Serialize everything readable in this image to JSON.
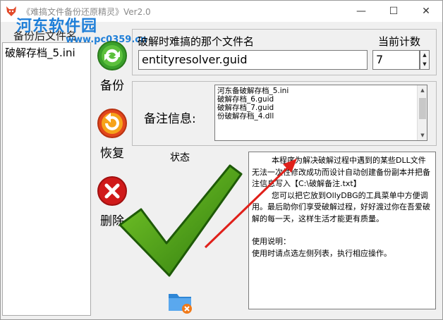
{
  "window": {
    "title": "《难搞文件备份还原精灵》Ver2.0",
    "controls": {
      "minimize": "—",
      "maximize": "☐",
      "close": "✕"
    }
  },
  "watermark": {
    "logo": "河东软件园",
    "url": "www.pc0359.cn"
  },
  "file_list": {
    "header": "备份后文件名",
    "items": [
      "破解存档_5.ini"
    ]
  },
  "actions": {
    "backup": "备份",
    "restore": "恢复",
    "delete": "删除"
  },
  "filename": {
    "label": "破解时难搞的那个文件名",
    "value": "entityresolver.guid"
  },
  "counter": {
    "label": "当前计数",
    "value": "7"
  },
  "notes": {
    "label": "备注信息:",
    "lines": [
      "河东备破解存档_5.ini",
      "破解存档_6.guid",
      "破解存档_7.guid",
      "份破解存档_4.dll"
    ]
  },
  "status": {
    "label": "状态"
  },
  "description": {
    "paragraphs": [
      "        本程序为解决破解过程中遇到的某些DLL文件无法一次性修改成功而设计自动创建备份副本并把备注信息写入【C:\\破解备注.txt】",
      "        您可以把它放到OllyDBG的工具菜单中方便调用。最后助你们享受破解过程，好好渡过你在吾爱破解的每一天，这样生活才能更有质量。",
      "",
      "使用说明：",
      "使用时请点选左侧列表，执行相应操作。"
    ]
  },
  "colors": {
    "check_green": "#4a9a12",
    "arrow_red": "#e0201a",
    "watermark_blue": "#1f7fd8"
  }
}
